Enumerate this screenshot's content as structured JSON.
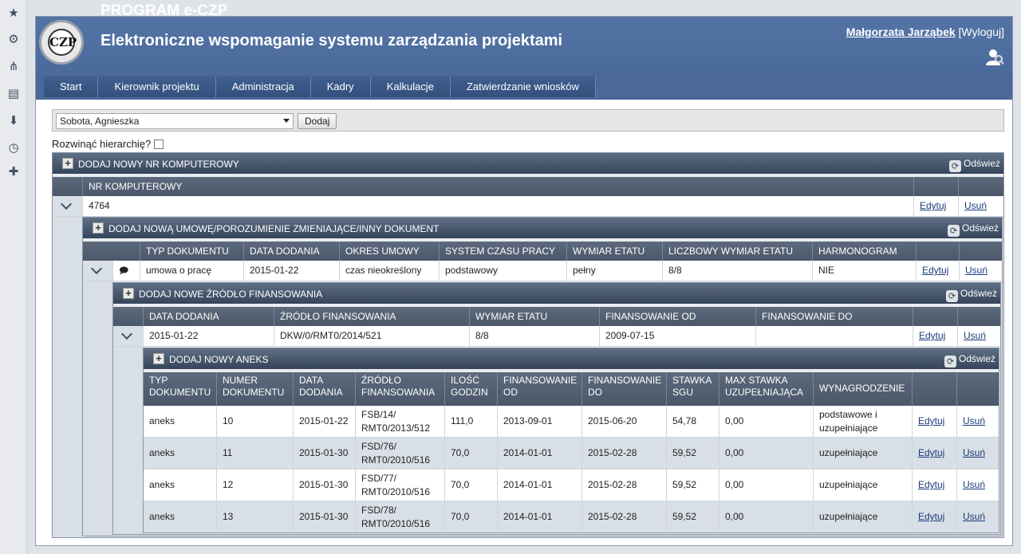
{
  "header": {
    "program_title": "PROGRAM e-CZP",
    "app_title": "Elektroniczne wspomaganie systemu zarządzania projektami",
    "logo_text": "CZP",
    "user_name": "Małgorzata Jarząbek",
    "logout": "[Wyloguj]"
  },
  "nav": [
    "Start",
    "Kierownik projektu",
    "Administracja",
    "Kadry",
    "Kalkulacje",
    "Zatwierdzanie wniosków"
  ],
  "employee_select": {
    "value": "Sobota, Agnieszka",
    "add_label": "Dodaj"
  },
  "expand_hierarchy_label": "Rozwinąć hierarchię?",
  "refresh_label": "Odśwież",
  "edit_label": "Edytuj",
  "delete_label": "Usuń",
  "computer_panel": {
    "add_label": "DODAJ NOWY NR KOMPUTEROWY",
    "header": "NR KOMPUTEROWY",
    "value": "4764"
  },
  "agreement_panel": {
    "add_label": "DODAJ NOWĄ UMOWĘ/POROZUMIENIE ZMIENIAJĄCE/INNY DOKUMENT",
    "headers": [
      "TYP DOKUMENTU",
      "DATA DODANIA",
      "OKRES UMOWY",
      "SYSTEM CZASU PRACY",
      "WYMIAR ETATU",
      "LICZBOWY WYMIAR ETATU",
      "HARMONOGRAM"
    ],
    "row": [
      "umowa o pracę",
      "2015-01-22",
      "czas nieokreślony",
      "podstawowy",
      "pełny",
      "8/8",
      "NIE"
    ]
  },
  "funding_panel": {
    "add_label": "DODAJ NOWE ŹRÓDŁO FINANSOWANIA",
    "headers": [
      "DATA DODANIA",
      "ŹRÓDŁO FINANSOWANIA",
      "WYMIAR ETATU",
      "FINANSOWANIE OD",
      "FINANSOWANIE DO"
    ],
    "row": [
      "2015-01-22",
      "DKW/0/RMT0/2014/521",
      "8/8",
      "2009-07-15",
      ""
    ]
  },
  "annex_panel": {
    "add_label": "DODAJ NOWY ANEKS",
    "headers": [
      [
        "TYP",
        "DOKUMENTU"
      ],
      [
        "NUMER",
        "DOKUMENTU"
      ],
      [
        "DATA",
        "DODANIA"
      ],
      [
        "ŹRÓDŁO",
        "FINANSOWANIA"
      ],
      [
        "ILOŚĆ",
        "GODZIN"
      ],
      [
        "FINANSOWANIE",
        "OD"
      ],
      [
        "FINANSOWANIE",
        "DO"
      ],
      [
        "STAWKA",
        "SGU"
      ],
      [
        "MAX STAWKA",
        "UZUPEŁNIAJĄCA"
      ],
      [
        "WYNAGRODZENIE",
        ""
      ]
    ],
    "rows": [
      {
        "type": "aneks",
        "number": "10",
        "date": "2015-01-22",
        "source": [
          "FSB/14/",
          "RMT0/2013/512"
        ],
        "hours": "111,0",
        "from": "2013-09-01",
        "to": "2015-06-20",
        "rate": "54,78",
        "max": "0,00",
        "pay": [
          "podstawowe i",
          "uzupełniające"
        ]
      },
      {
        "type": "aneks",
        "number": "11",
        "date": "2015-01-30",
        "source": [
          "FSD/76/",
          "RMT0/2010/516"
        ],
        "hours": "70,0",
        "from": "2014-01-01",
        "to": "2015-02-28",
        "rate": "59,52",
        "max": "0,00",
        "pay": [
          "uzupełniające",
          ""
        ]
      },
      {
        "type": "aneks",
        "number": "12",
        "date": "2015-01-30",
        "source": [
          "FSD/77/",
          "RMT0/2010/516"
        ],
        "hours": "70,0",
        "from": "2014-01-01",
        "to": "2015-02-28",
        "rate": "59,52",
        "max": "0,00",
        "pay": [
          "uzupełniające",
          ""
        ]
      },
      {
        "type": "aneks",
        "number": "13",
        "date": "2015-01-30",
        "source": [
          "FSD/78/",
          "RMT0/2010/516"
        ],
        "hours": "70,0",
        "from": "2014-01-01",
        "to": "2015-02-28",
        "rate": "59,52",
        "max": "0,00",
        "pay": [
          "uzupełniające",
          ""
        ]
      }
    ]
  }
}
